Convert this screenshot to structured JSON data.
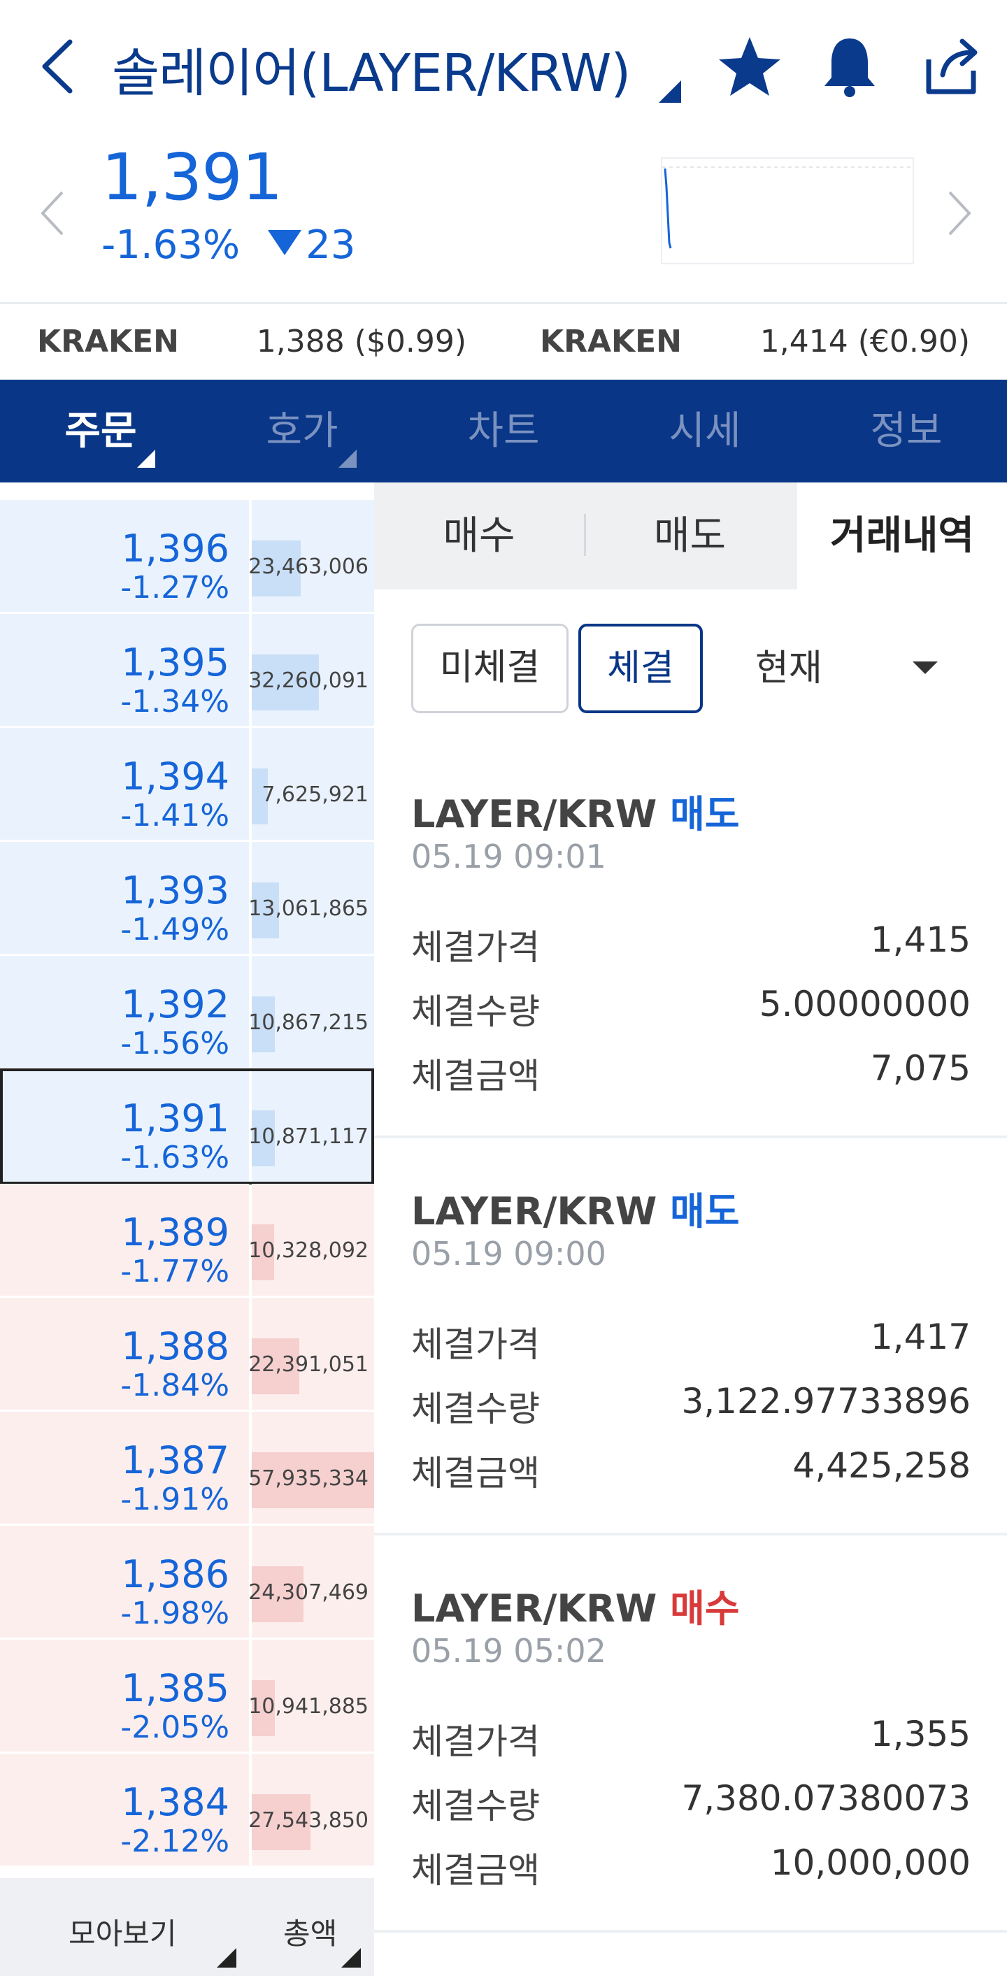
{
  "header": {
    "title": "솔레이어(LAYER/KRW)",
    "back_icon": "chevron-left-icon",
    "favorite_icon": "star-icon",
    "alert_icon": "bell-icon",
    "share_icon": "share-icon",
    "accent_color": "#0a3a8c"
  },
  "price": {
    "current": "1,391",
    "change_pct": "-1.63%",
    "change_abs": "23",
    "direction": "down",
    "color": "#1565d8"
  },
  "exchanges": [
    {
      "name": "KRAKEN",
      "value": "1,388 ($0.99)"
    },
    {
      "name": "KRAKEN",
      "value": "1,414 (€0.90)"
    }
  ],
  "tabs": [
    {
      "label": "주문",
      "active": true,
      "has_caret": true
    },
    {
      "label": "호가",
      "active": false,
      "has_caret": true
    },
    {
      "label": "차트",
      "active": false,
      "has_caret": false
    },
    {
      "label": "시세",
      "active": false,
      "has_caret": false
    },
    {
      "label": "정보",
      "active": false,
      "has_caret": false
    }
  ],
  "orderbook": {
    "rows": [
      {
        "price": "1,396",
        "pct": "-1.27%",
        "volume": "23,463,006",
        "side": "ask",
        "bar": 0.4
      },
      {
        "price": "1,395",
        "pct": "-1.34%",
        "volume": "32,260,091",
        "side": "ask",
        "bar": 0.55
      },
      {
        "price": "1,394",
        "pct": "-1.41%",
        "volume": "7,625,921",
        "side": "ask",
        "bar": 0.13
      },
      {
        "price": "1,393",
        "pct": "-1.49%",
        "volume": "13,061,865",
        "side": "ask",
        "bar": 0.22
      },
      {
        "price": "1,392",
        "pct": "-1.56%",
        "volume": "10,867,215",
        "side": "ask",
        "bar": 0.19
      },
      {
        "price": "1,391",
        "pct": "-1.63%",
        "volume": "10,871,117",
        "side": "ask",
        "bar": 0.19,
        "current": true
      },
      {
        "price": "1,389",
        "pct": "-1.77%",
        "volume": "10,328,092",
        "side": "bid",
        "bar": 0.18
      },
      {
        "price": "1,388",
        "pct": "-1.84%",
        "volume": "22,391,051",
        "side": "bid",
        "bar": 0.39
      },
      {
        "price": "1,387",
        "pct": "-1.91%",
        "volume": "57,935,334",
        "side": "bid",
        "bar": 1.0
      },
      {
        "price": "1,386",
        "pct": "-1.98%",
        "volume": "24,307,469",
        "side": "bid",
        "bar": 0.42
      },
      {
        "price": "1,385",
        "pct": "-2.05%",
        "volume": "10,941,885",
        "side": "bid",
        "bar": 0.19
      },
      {
        "price": "1,384",
        "pct": "-2.12%",
        "volume": "27,543,850",
        "side": "bid",
        "bar": 0.48
      }
    ],
    "footer": {
      "group_label": "모아보기",
      "total_label": "총액"
    }
  },
  "order_panel": {
    "subtabs": [
      {
        "label": "매수",
        "active": false
      },
      {
        "label": "매도",
        "active": false
      },
      {
        "label": "거래내역",
        "active": true
      }
    ],
    "filters": {
      "unfilled": "미체결",
      "filled": "체결",
      "period": "현재"
    },
    "trades": [
      {
        "pair": "LAYER/KRW",
        "side": "매도",
        "side_type": "sell",
        "time": "05.19 09:01",
        "price_label": "체결가격",
        "price": "1,415",
        "qty_label": "체결수량",
        "qty": "5.00000000",
        "amount_label": "체결금액",
        "amount": "7,075"
      },
      {
        "pair": "LAYER/KRW",
        "side": "매도",
        "side_type": "sell",
        "time": "05.19 09:00",
        "price_label": "체결가격",
        "price": "1,417",
        "qty_label": "체결수량",
        "qty": "3,122.97733896",
        "amount_label": "체결금액",
        "amount": "4,425,258"
      },
      {
        "pair": "LAYER/KRW",
        "side": "매수",
        "side_type": "buy",
        "time": "05.19 05:02",
        "price_label": "체결가격",
        "price": "1,355",
        "qty_label": "체결수량",
        "qty": "7,380.07380073",
        "amount_label": "체결금액",
        "amount": "10,000,000"
      }
    ]
  }
}
